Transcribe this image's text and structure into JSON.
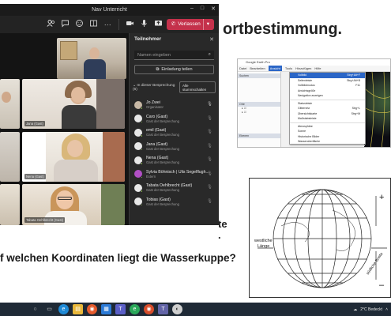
{
  "slide": {
    "title_fragment": "ortbestimmung.",
    "partial_line_1": "te",
    "partial_line_2": ".",
    "question": "f welchen Koordinaten liegt die Wasserkuppe?"
  },
  "google_earth": {
    "window_title": "Google Earth Pro",
    "menus": [
      "Datei",
      "Bearbeiten",
      "Ansicht",
      "Tools",
      "Hinzufügen",
      "Hilfe"
    ],
    "selected_menu": "Ansicht",
    "left_panel_header": "Suchen",
    "left_panel_places": "Orte",
    "left_panel_layers": "Ebenen",
    "menu_items": [
      {
        "label": "Vollbild",
        "shortcut": "Strg+Alt+F",
        "highlighted": true
      },
      {
        "label": "Seitenleiste",
        "shortcut": "Strg+Alt+B",
        "highlighted": false
      },
      {
        "label": "Vollbildmodus",
        "shortcut": "F11",
        "highlighted": false
      },
      {
        "label": "Ansichtsgröße",
        "shortcut": "",
        "highlighted": false
      },
      {
        "label": "Navigation anzeigen",
        "shortcut": "",
        "highlighted": false
      },
      {
        "label": "Statusleiste",
        "shortcut": "",
        "highlighted": false
      },
      {
        "label": "Gitternetz",
        "shortcut": "Strg+L",
        "highlighted": false
      },
      {
        "label": "Übersichtskarte",
        "shortcut": "Strg+M",
        "highlighted": false
      },
      {
        "label": "Maßstabsleiste",
        "shortcut": "",
        "highlighted": false
      },
      {
        "label": "Atmosphäre",
        "shortcut": "",
        "highlighted": false
      },
      {
        "label": "Sonne",
        "shortcut": "",
        "highlighted": false
      },
      {
        "label": "Historische Bilder",
        "shortcut": "",
        "highlighted": false
      },
      {
        "label": "Wasseroberfläche",
        "shortcut": "",
        "highlighted": false
      },
      {
        "label": "Erkunden",
        "shortcut": "",
        "highlighted": false
      },
      {
        "label": "Zurücksetzen",
        "shortcut": "",
        "highlighted": false
      },
      {
        "label": "Zu meiner Startposition wechseln",
        "shortcut": "",
        "highlighted": false
      }
    ]
  },
  "globe": {
    "plus": "+",
    "minus": "–",
    "west_label_1": "westliche",
    "west_label_2": "Länge",
    "south_label": "südliche Breite"
  },
  "teams": {
    "window_title": "Nav Unterricht",
    "leave_label": "Verlassen",
    "panel_title": "Teilnehmer",
    "search_placeholder": "Namen eingeben",
    "invite_label": "Einladung teilen",
    "section_label": "In dieser Besprechung (6)",
    "mute_all_label": "Alle stummschalten",
    "tiles": {
      "jana": "Jana (Gast)",
      "nena": "Nena (Gast)",
      "tabata": "Tabata Oehlbrecht (Gast)"
    },
    "participants": [
      {
        "name": "Jo Zwei",
        "role": "Organisator",
        "color": "#c7b8a5"
      },
      {
        "name": "Caro (Gast)",
        "role": "Gast der Besprechung",
        "color": "#e8e8e8"
      },
      {
        "name": "emil (Gast)",
        "role": "Gast der Besprechung",
        "color": "#e8e8e8"
      },
      {
        "name": "Jana (Gast)",
        "role": "Gast der Besprechung",
        "color": "#e8e8e8"
      },
      {
        "name": "Nena (Gast)",
        "role": "Gast der Besprechung",
        "color": "#e8e8e8"
      },
      {
        "name": "Sylvia Böhnisch | Ulis Segelflugh...",
        "role": "Extern",
        "color": "#b14fc5"
      },
      {
        "name": "Tabata Oehlbrecht (Gast)",
        "role": "Gast der Besprechung",
        "color": "#e8e8e8"
      },
      {
        "name": "Tobias (Gast)",
        "role": "Gast der Besprechung",
        "color": "#e8e8e8"
      }
    ]
  },
  "tray": {
    "weather": "2°C Bedeckt"
  }
}
